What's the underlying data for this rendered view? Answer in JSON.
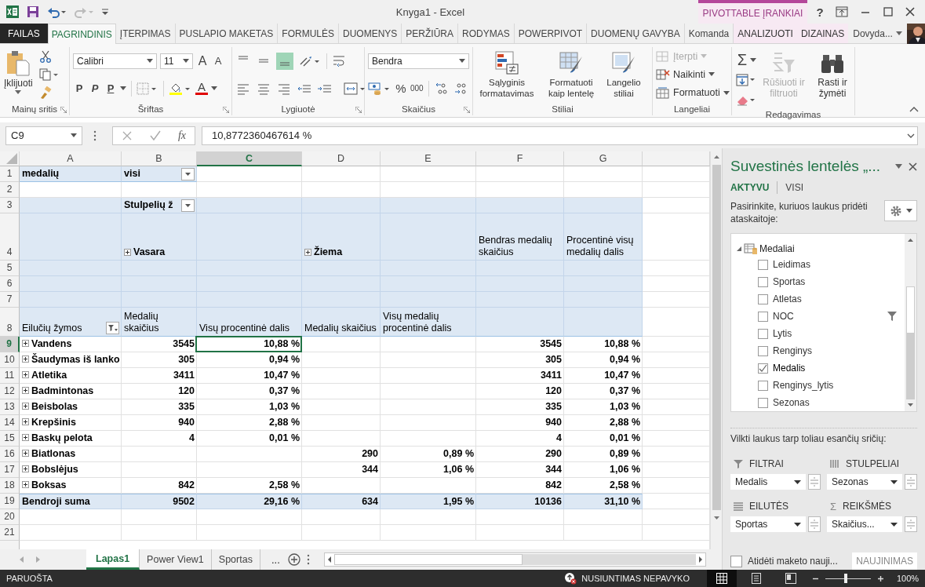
{
  "title_bar": {
    "title": "Knyga1 - Excel",
    "contextual_label": "PIVOTTABLE ĮRANKIAI",
    "help": "?"
  },
  "ribbon_tabs": [
    {
      "label": "FAILAS",
      "kind": "file",
      "selected": false
    },
    {
      "label": "PAGRINDINIS",
      "kind": "normal",
      "selected": true
    },
    {
      "label": "ĮTERPIMAS",
      "kind": "normal",
      "selected": false
    },
    {
      "label": "PUSLAPIO MAKETAS",
      "kind": "normal",
      "selected": false
    },
    {
      "label": "FORMULĖS",
      "kind": "normal",
      "selected": false
    },
    {
      "label": "DUOMENYS",
      "kind": "normal",
      "selected": false
    },
    {
      "label": "PERŽIŪRA",
      "kind": "normal",
      "selected": false
    },
    {
      "label": "RODYMAS",
      "kind": "normal",
      "selected": false
    },
    {
      "label": "POWERPIVOT",
      "kind": "normal",
      "selected": false
    },
    {
      "label": "DUOMENŲ GAVYBA",
      "kind": "normal",
      "selected": false
    },
    {
      "label": "Komanda",
      "kind": "normal",
      "selected": false
    },
    {
      "label": "ANALIZUOTI",
      "kind": "contextual",
      "selected": false
    },
    {
      "label": "DIZAINAS",
      "kind": "contextual",
      "selected": false
    }
  ],
  "user": {
    "name": "Dovyda..."
  },
  "ribbon": {
    "clipboard": {
      "paste": "Įklijuoti",
      "label": "Mainų sritis"
    },
    "font": {
      "family": "Calibri",
      "size": "11",
      "grow": "A",
      "shrink": "A",
      "bold": "P",
      "italic": "P",
      "underline": "P",
      "font_color": "A",
      "label": "Šriftas"
    },
    "alignment": {
      "label": "Lygiuotė"
    },
    "number": {
      "format": "Bendra",
      "percent": "%",
      "thousands": "000",
      "label": "Skaičius"
    },
    "styles": {
      "buttons": [
        "Sąlyginis formatavimas",
        "Formatuoti kaip lentelę",
        "Langelio stiliai"
      ],
      "label": "Stiliai"
    },
    "cells": {
      "items": [
        {
          "label": "Įterpti",
          "kind": "insert",
          "disabled": true
        },
        {
          "label": "Naikinti",
          "kind": "delete",
          "disabled": false
        },
        {
          "label": "Formatuoti",
          "kind": "format",
          "disabled": false
        }
      ],
      "label": "Langeliai"
    },
    "editing": {
      "autosum": "Σ",
      "items": [
        {
          "label": "Rūšiuoti ir filtruoti",
          "kind": "sort",
          "disabled": true
        },
        {
          "label": "Rasti ir žymėti",
          "kind": "find",
          "disabled": false
        }
      ],
      "label": "Redagavimas"
    }
  },
  "formula_bar": {
    "name_box": "C9",
    "fx": "fx",
    "formula": "10,8772360467614 %"
  },
  "columns": [
    {
      "letter": "A",
      "selected": false
    },
    {
      "letter": "B",
      "selected": false
    },
    {
      "letter": "C",
      "selected": true
    },
    {
      "letter": "D",
      "selected": false
    },
    {
      "letter": "E",
      "selected": false
    },
    {
      "letter": "F",
      "selected": false
    },
    {
      "letter": "G",
      "selected": false
    }
  ],
  "rows": [
    {
      "number": "1",
      "kind": "filter",
      "selected": false,
      "cells": [
        "medalių",
        {
          "text": "visi",
          "dropdown": true
        }
      ]
    },
    {
      "number": "2",
      "kind": "blank",
      "selected": false,
      "cells": []
    },
    {
      "number": "3",
      "kind": "header",
      "selected": false,
      "cells": [
        null,
        {
          "text": "Stulpelių ž",
          "dropdown": true
        }
      ]
    },
    {
      "number": "4",
      "kind": "group",
      "selected": false,
      "cells": [
        null,
        {
          "text": "Vasara",
          "expanded": false
        },
        null,
        {
          "text": "Žiema",
          "expanded": false
        },
        null,
        "Bendras medalių skaičius",
        "Procentinė visų medalių dalis"
      ]
    },
    {
      "number": "5",
      "kind": "header",
      "selected": false,
      "cells": []
    },
    {
      "number": "6",
      "kind": "header",
      "selected": false,
      "cells": []
    },
    {
      "number": "7",
      "kind": "header",
      "selected": false,
      "cells": []
    },
    {
      "number": "8",
      "kind": "field",
      "selected": false,
      "cells": [
        {
          "text": "Eilučių žymos",
          "filter": true
        },
        "Medalių skaičius",
        "Visų procentinė dalis",
        "Medalių skaičius",
        "Visų medalių procentinė dalis"
      ]
    },
    {
      "number": "9",
      "kind": "data",
      "selected": true,
      "cells": [
        {
          "text": "Vandens",
          "expanded": false
        },
        "3545",
        "10,88 %",
        null,
        null,
        "3545",
        "10,88 %"
      ]
    },
    {
      "number": "10",
      "kind": "data",
      "selected": false,
      "cells": [
        {
          "text": "Šaudymas iš lanko",
          "expanded": false
        },
        "305",
        "0,94 %",
        null,
        null,
        "305",
        "0,94 %"
      ]
    },
    {
      "number": "11",
      "kind": "data",
      "selected": false,
      "cells": [
        {
          "text": "Atletika",
          "expanded": false
        },
        "3411",
        "10,47 %",
        null,
        null,
        "3411",
        "10,47 %"
      ]
    },
    {
      "number": "12",
      "kind": "data",
      "selected": false,
      "cells": [
        {
          "text": "Badmintonas",
          "expanded": false
        },
        "120",
        "0,37 %",
        null,
        null,
        "120",
        "0,37 %"
      ]
    },
    {
      "number": "13",
      "kind": "data",
      "selected": false,
      "cells": [
        {
          "text": "Beisbolas",
          "expanded": false
        },
        "335",
        "1,03 %",
        null,
        null,
        "335",
        "1,03 %"
      ]
    },
    {
      "number": "14",
      "kind": "data",
      "selected": false,
      "cells": [
        {
          "text": "Krepšinis",
          "expanded": false
        },
        "940",
        "2,88 %",
        null,
        null,
        "940",
        "2,88 %"
      ]
    },
    {
      "number": "15",
      "kind": "data",
      "selected": false,
      "cells": [
        {
          "text": "Baskų pelota",
          "expanded": false
        },
        "4",
        "0,01 %",
        null,
        null,
        "4",
        "0,01 %"
      ]
    },
    {
      "number": "16",
      "kind": "data",
      "selected": false,
      "cells": [
        {
          "text": "Biatlonas",
          "expanded": false
        },
        null,
        null,
        "290",
        "0,89 %",
        "290",
        "0,89 %"
      ]
    },
    {
      "number": "17",
      "kind": "data",
      "selected": false,
      "cells": [
        {
          "text": "Bobslėjus",
          "expanded": false
        },
        null,
        null,
        "344",
        "1,06 %",
        "344",
        "1,06 %"
      ]
    },
    {
      "number": "18",
      "kind": "data",
      "selected": false,
      "cells": [
        {
          "text": "Boksas",
          "expanded": false
        },
        "842",
        "2,58 %",
        null,
        null,
        "842",
        "2,58 %"
      ]
    },
    {
      "number": "19",
      "kind": "total",
      "selected": false,
      "cells": [
        "Bendroji suma",
        "9502",
        "29,16 %",
        "634",
        "1,95 %",
        "10136",
        "31,10 %"
      ]
    },
    {
      "number": "20",
      "kind": "blank",
      "selected": false,
      "cells": []
    },
    {
      "number": "21",
      "kind": "blank",
      "selected": false,
      "cells": []
    }
  ],
  "sheet_tabs": [
    {
      "label": "Lapas1",
      "selected": true
    },
    {
      "label": "Power View1",
      "selected": false
    },
    {
      "label": "Sportas",
      "selected": false
    }
  ],
  "more_sheets": "...",
  "field_pane": {
    "title": "Suvestinės lentelės „...",
    "tabs": [
      {
        "label": "AKTYVU",
        "selected": true
      },
      {
        "label": "VISI",
        "selected": false
      }
    ],
    "prompt": "Pasirinkite, kuriuos laukus pridėti ataskaitoje:",
    "table": {
      "name": "Medaliai",
      "expanded": true,
      "fields": [
        {
          "name": "Leidimas",
          "checked": false,
          "filtered": false
        },
        {
          "name": "Sportas",
          "checked": false,
          "filtered": false
        },
        {
          "name": "Atletas",
          "checked": false,
          "filtered": false
        },
        {
          "name": "NOC",
          "checked": false,
          "filtered": true
        },
        {
          "name": "Lytis",
          "checked": false,
          "filtered": false
        },
        {
          "name": "Renginys",
          "checked": false,
          "filtered": false
        },
        {
          "name": "Medalis",
          "checked": true,
          "filtered": false
        },
        {
          "name": "Renginys_lytis",
          "checked": false,
          "filtered": false
        },
        {
          "name": "Sezonas",
          "checked": false,
          "filtered": false
        }
      ]
    },
    "drag_hint": "Vilkti laukus tarp toliau esančių sričių:",
    "areas": [
      {
        "kind": "filters",
        "label": "FILTRAI",
        "field": "Medalis"
      },
      {
        "kind": "columns",
        "label": "STULPELIAI",
        "field": "Sezonas"
      },
      {
        "kind": "rows",
        "label": "EILUTĖS",
        "field": "Sportas"
      },
      {
        "kind": "values",
        "label": "REIKŠMĖS",
        "field": "Skaičius...",
        "symbol": "Σ"
      }
    ],
    "defer": {
      "label": "Atidėti maketo nauji...",
      "checked": false
    },
    "update_button": {
      "label": "NAUJINIMAS",
      "disabled": true
    }
  },
  "status_bar": {
    "status": "PARUOŠTA",
    "upload": "NUSIUNTIMAS NEPAVYKO",
    "views": [
      {
        "kind": "normal",
        "selected": true
      },
      {
        "kind": "page_layout",
        "selected": false
      },
      {
        "kind": "page_break",
        "selected": false
      }
    ],
    "zoom": {
      "level": 0.45
    },
    "zoom_text": "100%"
  }
}
